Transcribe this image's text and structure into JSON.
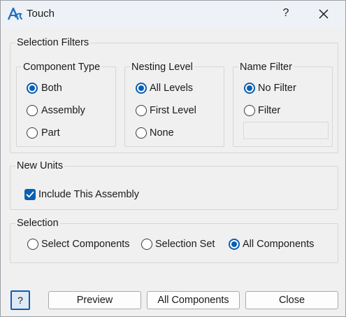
{
  "window": {
    "title": "Touch",
    "help_label": "?"
  },
  "selection_filters": {
    "title": "Selection Filters",
    "component_type": {
      "title": "Component Type",
      "options": [
        {
          "label": "Both",
          "selected": true
        },
        {
          "label": "Assembly",
          "selected": false
        },
        {
          "label": "Part",
          "selected": false
        }
      ]
    },
    "nesting_level": {
      "title": "Nesting Level",
      "options": [
        {
          "label": "All Levels",
          "selected": true
        },
        {
          "label": "First Level",
          "selected": false
        },
        {
          "label": "None",
          "selected": false
        }
      ]
    },
    "name_filter": {
      "title": "Name Filter",
      "options": [
        {
          "label": "No Filter",
          "selected": true
        },
        {
          "label": "Filter",
          "selected": false
        }
      ],
      "filter_value": ""
    }
  },
  "new_units": {
    "title": "New Units",
    "include_label": "Include This Assembly",
    "include_checked": true
  },
  "selection": {
    "title": "Selection",
    "options": [
      {
        "label": "Select Components",
        "selected": false
      },
      {
        "label": "Selection Set",
        "selected": false
      },
      {
        "label": "All Components",
        "selected": true
      }
    ]
  },
  "buttons": {
    "help": "?",
    "preview": "Preview",
    "all_components": "All Components",
    "close": "Close"
  },
  "colors": {
    "accent": "#0a5fb4",
    "titlebar": "#eef1f6",
    "background": "#f0f0f0"
  },
  "icons": {
    "app": "app-logo-icon",
    "close": "close-icon",
    "check": "checkmark-icon"
  }
}
